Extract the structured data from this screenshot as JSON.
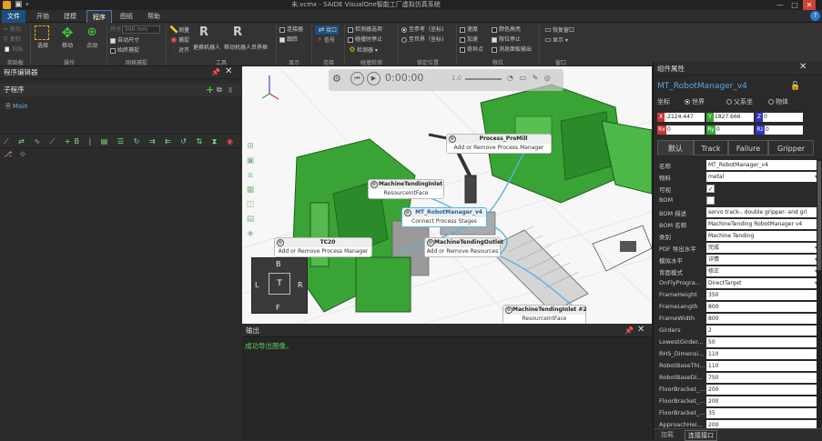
{
  "app": {
    "title": "未.vcmx - SAIDE VisualOne智能工厂虚拟仿真系统"
  },
  "menu": [
    "文件",
    "开始",
    "建模",
    "程序",
    "图纸",
    "帮助"
  ],
  "ribbon": {
    "clipboard": {
      "cut": "剪切",
      "copy": "复制",
      "paste": "粘贴",
      "delete": "删除",
      "group": "剪贴板"
    },
    "operate": {
      "select": "选择",
      "move": "移动",
      "point": "点动",
      "group": "操作"
    },
    "grid": {
      "size_label": "尺寸",
      "size_value": "500 mm",
      "auto_size": "自动尺寸",
      "snap": "始终捕捉",
      "group": "网格捕捉"
    },
    "tools": {
      "measure": "测量",
      "capture": "捕捉",
      "align": "对齐",
      "replace_robot": "更换机器人",
      "move_robot_world": "移动机器人世界框",
      "group": "工具"
    },
    "display": {
      "connectors": "连接器",
      "follow": "跟踪",
      "group": "显示"
    },
    "connect": {
      "interface": "接口",
      "signal": "信号",
      "group": "连接"
    },
    "collision": {
      "detector": "检测器选项",
      "stop_on_detect": "碰撞时停止",
      "detector_menu": "检测器",
      "group": "碰撞检测"
    },
    "pose": {
      "ref": "至参考（坐标)",
      "world": "至世界（坐标)",
      "group": "锁定位置"
    },
    "limits": {
      "speed": "速度",
      "accel": "加速",
      "singular": "奇异点",
      "highlight": "颜色高亮",
      "stop_limit": "限位停止",
      "msg": "消息面板输出",
      "group": "限位"
    },
    "window": {
      "restore": "恢复窗口",
      "show": "显示",
      "group": "窗口"
    }
  },
  "left": {
    "title": "程序编辑器",
    "subprogram": "子程序",
    "main": "Main"
  },
  "viewport": {
    "time": "0:00:00",
    "speed": "1.0",
    "nodes": [
      {
        "title": "Process_ProMill",
        "body": "Add or Remove Process Manager"
      },
      {
        "title": "MachineTendingInlet",
        "body": "ResourceIntFace"
      },
      {
        "title": "MT_RobotManager_v4",
        "body": "Connect Process Stages"
      },
      {
        "title": "TC20",
        "body": "Add or Remove Process Manager"
      },
      {
        "title": "MachineTendingOutlet",
        "body": "Add or Remove Resources"
      },
      {
        "title": "MachineTendingInlet #2",
        "body": "ResourceIntFace"
      }
    ],
    "cube": {
      "top": "B",
      "left": "L",
      "center": "T",
      "right": "R",
      "bottom": "F"
    }
  },
  "output": {
    "title": "输出",
    "message": "成功导出图像。"
  },
  "props": {
    "title": "组件属性",
    "name": "MT_RobotManager_v4",
    "coord_label": "坐标",
    "coord_opts": [
      "世界",
      "父系坐",
      "物体"
    ],
    "x": "-2124.447",
    "y": "1827.666",
    "z": "0",
    "rx": "0",
    "ry": "0",
    "rz": "0",
    "tabs": [
      "默认",
      "Track",
      "Failure",
      "Gripper"
    ],
    "rows": [
      {
        "k": "名称",
        "v": "MT_RobotManager_v4"
      },
      {
        "k": "物料",
        "v": "metal"
      },
      {
        "k": "可视",
        "v": ""
      },
      {
        "k": "BOM",
        "v": ""
      },
      {
        "k": "BOM 描述",
        "v": "servo track-, double gripper- and gri"
      },
      {
        "k": "BOM 名称",
        "v": "MachineTending RobotManager v4"
      },
      {
        "k": "类别",
        "v": "Machine Tending"
      },
      {
        "k": "PDF 导出水平",
        "v": "完成"
      },
      {
        "k": "模拟水平",
        "v": "详情"
      },
      {
        "k": "背面模式",
        "v": "修正"
      },
      {
        "k": "OnFlyProgra...",
        "v": "DirectTarget"
      },
      {
        "k": "FrameHeight",
        "v": "350"
      },
      {
        "k": "FrameLength",
        "v": "800"
      },
      {
        "k": "FrameWidth",
        "v": "800"
      },
      {
        "k": "Girders",
        "v": "2"
      },
      {
        "k": "LowestGirder...",
        "v": "50"
      },
      {
        "k": "RHS_Dimensi...",
        "v": "110"
      },
      {
        "k": "RobotBaseThi...",
        "v": "110"
      },
      {
        "k": "RobotBaseDi...",
        "v": "750"
      },
      {
        "k": "FloorBracket_...",
        "v": "200"
      },
      {
        "k": "FloorBracket_...",
        "v": "200"
      },
      {
        "k": "FloorBracket_...",
        "v": "35"
      },
      {
        "k": "ApproachHei...",
        "v": "200"
      }
    ],
    "bottom_tabs": [
      "加载",
      "连接接口"
    ]
  }
}
